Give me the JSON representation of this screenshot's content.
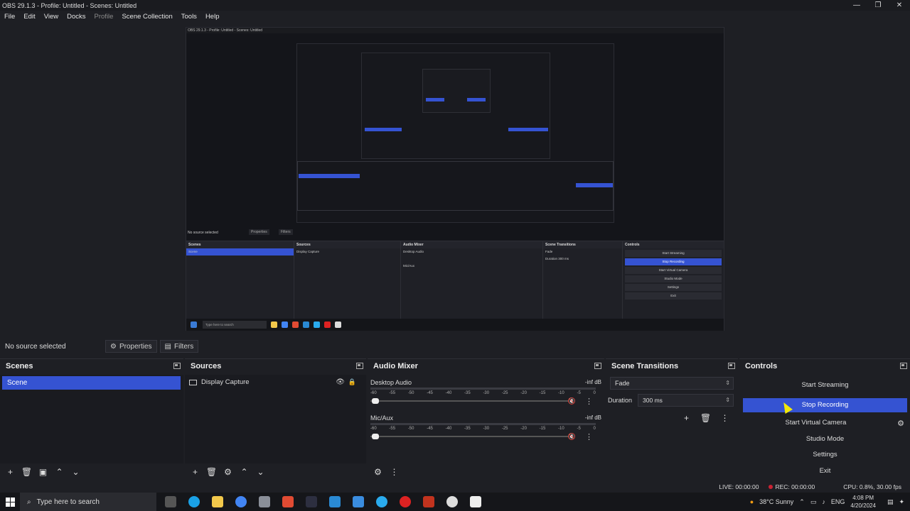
{
  "window": {
    "title": "OBS 29.1.3 - Profile: Untitled - Scenes: Untitled",
    "minimize": "—",
    "maximize": "❐",
    "close": "✕"
  },
  "menu": [
    "File",
    "Edit",
    "View",
    "Docks",
    "Profile",
    "Scene Collection",
    "Tools",
    "Help"
  ],
  "source_toolbar": {
    "no_source": "No source selected",
    "properties": "Properties",
    "filters": "Filters"
  },
  "scenes": {
    "title": "Scenes",
    "items": [
      "Scene"
    ]
  },
  "sources": {
    "title": "Sources",
    "items": [
      "Display Capture"
    ]
  },
  "mixer": {
    "title": "Audio Mixer",
    "channels": [
      {
        "name": "Desktop Audio",
        "level": "-inf dB"
      },
      {
        "name": "Mic/Aux",
        "level": "-inf dB"
      }
    ],
    "ticks": [
      "-60",
      "-55",
      "-50",
      "-45",
      "-40",
      "-35",
      "-30",
      "-25",
      "-20",
      "-15",
      "-10",
      "-5",
      "0"
    ]
  },
  "transitions": {
    "title": "Scene Transitions",
    "selected": "Fade",
    "duration_label": "Duration",
    "duration_value": "300 ms"
  },
  "controls": {
    "title": "Controls",
    "start_streaming": "Start Streaming",
    "stop_recording": "Stop Recording",
    "start_virtual_camera": "Start Virtual Camera",
    "studio_mode": "Studio Mode",
    "settings": "Settings",
    "exit": "Exit"
  },
  "status": {
    "live": "LIVE: 00:00:00",
    "rec": "REC: 00:00:00",
    "cpu": "CPU: 0.8%, 30.00 fps"
  },
  "taskbar": {
    "search_placeholder": "Type here to search",
    "weather": "38°C  Sunny",
    "lang": "ENG",
    "time": "4:08 PM",
    "date": "4/20/2024"
  },
  "preview": {
    "title": "OBS 29.1.3 - Profile: Untitled - Scenes: Untitled",
    "no_source": "No source selected",
    "properties": "Properties",
    "filters": "Filters",
    "scenes": "Scenes",
    "scene": "Scene",
    "sources": "Sources",
    "display_capture": "Display Capture",
    "audio_mixer": "Audio Mixer",
    "desktop_audio": "Desktop Audio",
    "mic_aux": "Mic/Aux",
    "scene_transitions": "Scene Transitions",
    "fade": "Fade",
    "duration": "Duration",
    "duration_value": "300 ms",
    "controls": "Controls",
    "start_streaming": "Start Streaming",
    "stop_recording": "Stop Recording",
    "start_virtual_camera": "Start Virtual Camera",
    "studio_mode": "Studio Mode",
    "settings": "Settings",
    "exit": "Exit",
    "search": "Type here to search"
  },
  "colors": {
    "accent": "#3553d2",
    "background": "#1e1f24",
    "panel": "#1a1b20"
  }
}
